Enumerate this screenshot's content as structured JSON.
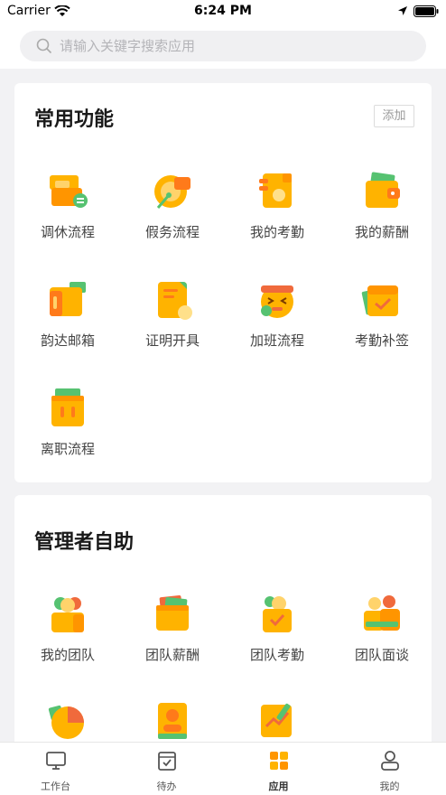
{
  "status": {
    "carrier": "Carrier",
    "time": "6:24 PM"
  },
  "search": {
    "placeholder": "请输入关键字搜索应用"
  },
  "common": {
    "title": "常用功能",
    "add_label": "添加",
    "items": [
      {
        "label": "调休流程",
        "icon": "swap-leave-icon"
      },
      {
        "label": "假务流程",
        "icon": "leave-flow-icon"
      },
      {
        "label": "我的考勤",
        "icon": "attendance-icon"
      },
      {
        "label": "我的薪酬",
        "icon": "wallet-icon"
      },
      {
        "label": "韵达邮箱",
        "icon": "mailbox-icon"
      },
      {
        "label": "证明开具",
        "icon": "certificate-icon"
      },
      {
        "label": "加班流程",
        "icon": "overtime-icon"
      },
      {
        "label": "考勤补签",
        "icon": "calendar-check-icon"
      },
      {
        "label": "离职流程",
        "icon": "resign-box-icon"
      }
    ]
  },
  "manager": {
    "title": "管理者自助",
    "items": [
      {
        "label": "我的团队",
        "icon": "team-icon"
      },
      {
        "label": "团队薪酬",
        "icon": "team-salary-icon"
      },
      {
        "label": "团队考勤",
        "icon": "team-attendance-icon"
      },
      {
        "label": "团队面谈",
        "icon": "team-interview-icon"
      },
      {
        "label": "",
        "icon": "pie-chart-icon"
      },
      {
        "label": "",
        "icon": "profile-card-icon"
      },
      {
        "label": "",
        "icon": "report-chart-icon"
      }
    ]
  },
  "tabs": [
    {
      "label": "工作台",
      "icon": "monitor-icon"
    },
    {
      "label": "待办",
      "icon": "todo-icon"
    },
    {
      "label": "应用",
      "icon": "apps-grid-icon",
      "active": true
    },
    {
      "label": "我的",
      "icon": "person-icon"
    }
  ],
  "colors": {
    "accent": "#f5a623",
    "orange": "#ff9500",
    "green": "#56c271",
    "red": "#f06a3c"
  }
}
